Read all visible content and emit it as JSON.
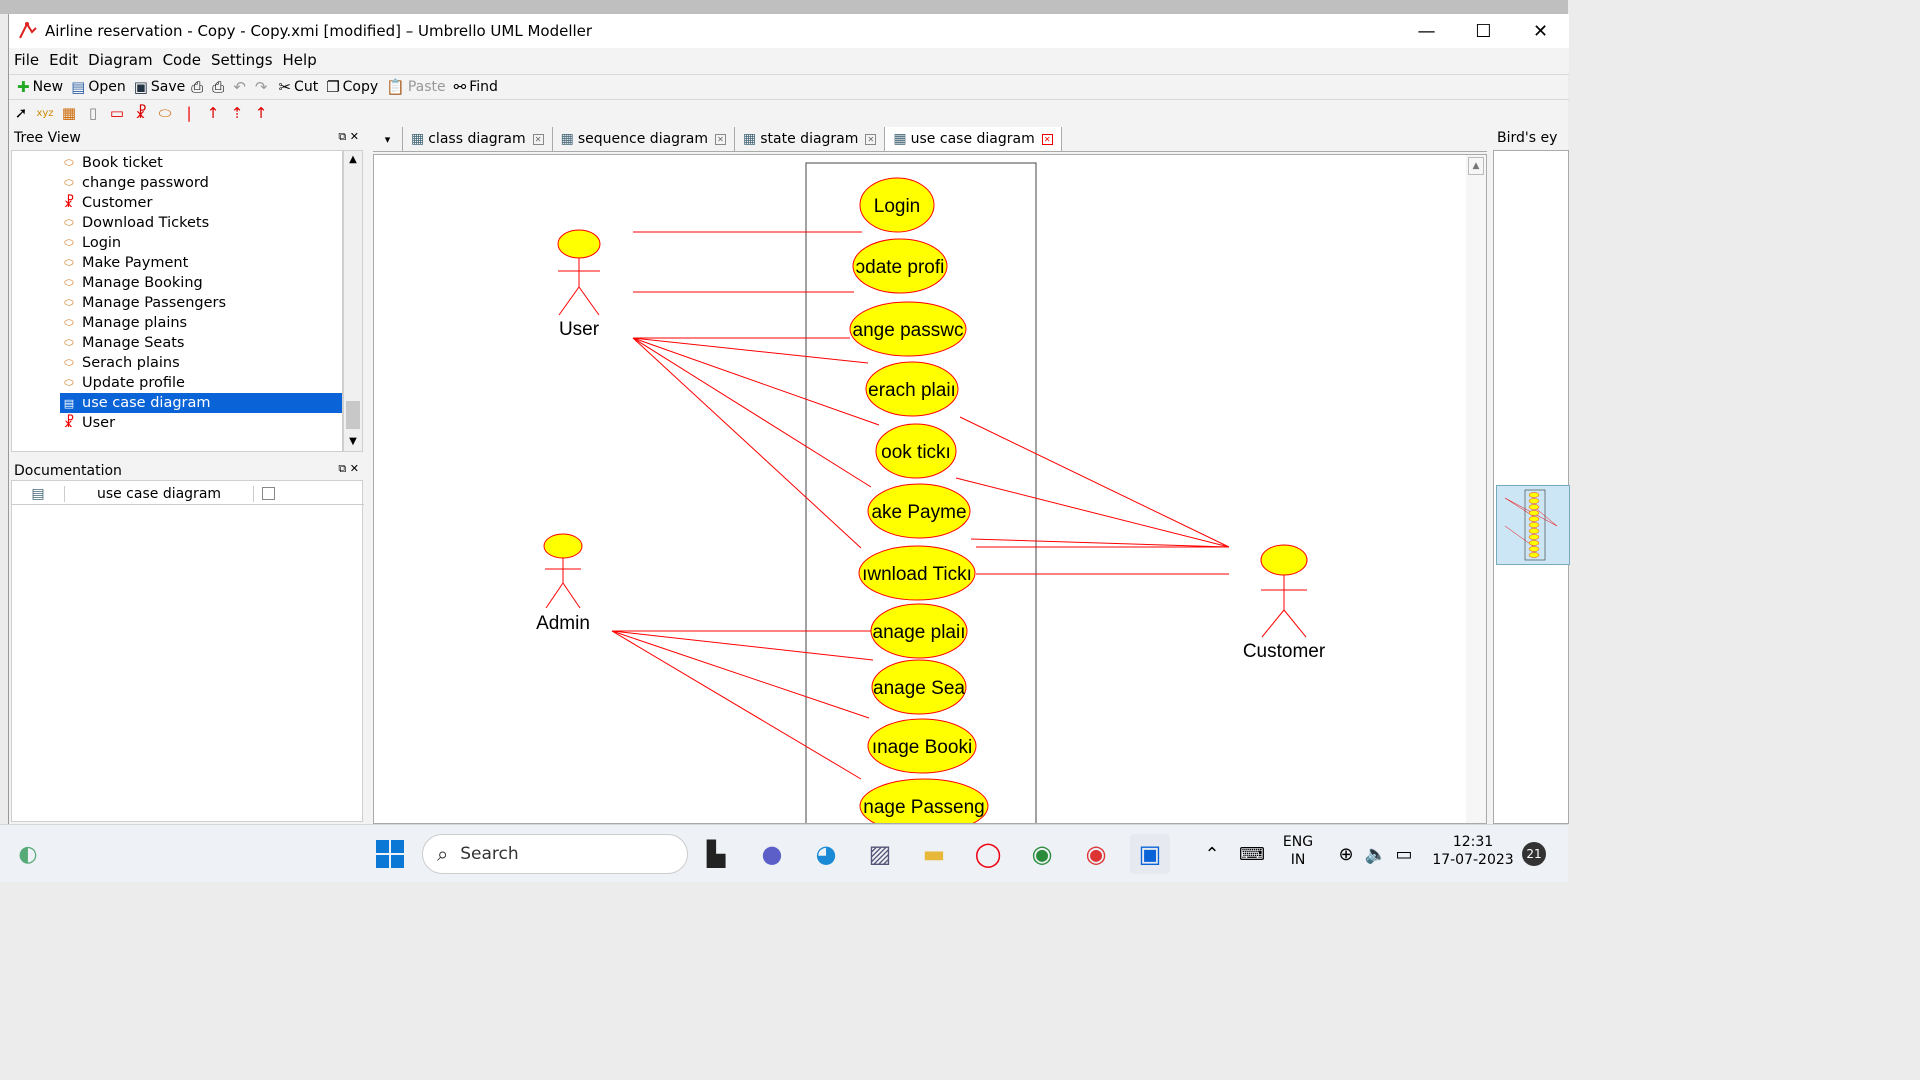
{
  "window": {
    "title": "Airline reservation - Copy - Copy.xmi [modified] – Umbrello UML Modeller",
    "min": "—",
    "max": "☐",
    "close": "✕"
  },
  "menu": [
    "File",
    "Edit",
    "Diagram",
    "Code",
    "Settings",
    "Help"
  ],
  "toolbar": {
    "new": "New",
    "open": "Open",
    "save": "Save",
    "cut": "Cut",
    "copy": "Copy",
    "paste": "Paste",
    "find": "Find"
  },
  "tree_view": {
    "title": "Tree View",
    "items": [
      {
        "label": "Book ticket",
        "kind": "usecase"
      },
      {
        "label": "change password",
        "kind": "usecase"
      },
      {
        "label": "Customer",
        "kind": "actor"
      },
      {
        "label": "Download Tickets",
        "kind": "usecase"
      },
      {
        "label": "Login",
        "kind": "usecase"
      },
      {
        "label": "Make Payment",
        "kind": "usecase"
      },
      {
        "label": "Manage Booking",
        "kind": "usecase"
      },
      {
        "label": "Manage Passengers",
        "kind": "usecase"
      },
      {
        "label": "Manage plains",
        "kind": "usecase"
      },
      {
        "label": "Manage Seats",
        "kind": "usecase"
      },
      {
        "label": "Serach plains",
        "kind": "usecase"
      },
      {
        "label": "Update profile",
        "kind": "usecase"
      },
      {
        "label": "use case diagram",
        "kind": "diagram",
        "selected": true
      },
      {
        "label": "User",
        "kind": "actor"
      }
    ]
  },
  "documentation": {
    "title": "Documentation",
    "row_label": "use case diagram"
  },
  "tabs": [
    {
      "label": "class diagram",
      "active": false
    },
    {
      "label": "sequence diagram",
      "active": false
    },
    {
      "label": "state diagram",
      "active": false
    },
    {
      "label": "use case diagram",
      "active": true
    }
  ],
  "birds_eye": {
    "title": "Bird's ey"
  },
  "diagram": {
    "actors": [
      "User",
      "Admin",
      "Customer"
    ],
    "usecases": [
      "Login",
      "ɔdate profi",
      "ange passwc",
      "erach plaiı",
      "ook tickı",
      "ake Payme",
      "ıwnload Tickı",
      "anage plaiı",
      "anage Sea",
      "ınage Booki",
      "nage Passeng"
    ],
    "colors": {
      "usecase_fill": "#ffff00",
      "line": "#ff0000",
      "outline": "#ff0000"
    }
  },
  "taskbar": {
    "search": "Search",
    "lang1": "ENG",
    "lang2": "IN",
    "time": "12:31",
    "date": "17-07-2023",
    "badge": "21"
  }
}
